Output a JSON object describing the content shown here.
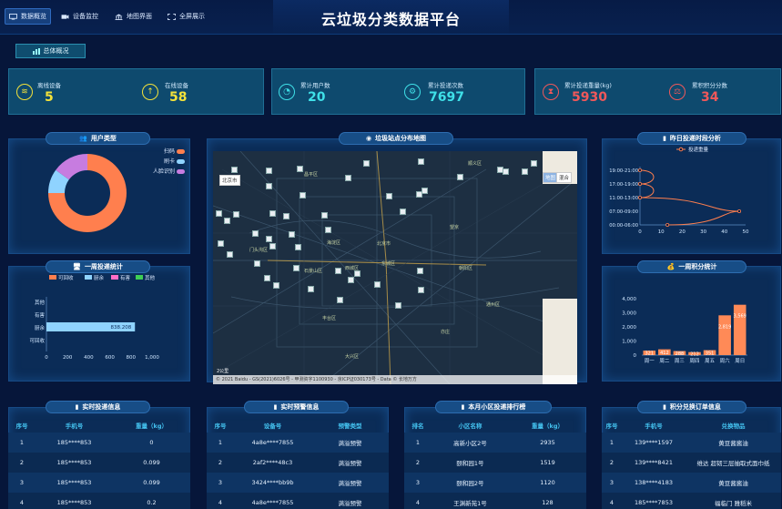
{
  "header": {
    "title": "云垃圾分类数据平台",
    "nav": [
      {
        "label": "数据概览",
        "icon": "monitor-icon",
        "active": true
      },
      {
        "label": "设备监控",
        "icon": "camera-icon",
        "active": false
      },
      {
        "label": "地图界面",
        "icon": "building-icon",
        "active": false
      },
      {
        "label": "全屏展示",
        "icon": "fullscreen-icon",
        "active": false
      }
    ]
  },
  "overview_tab": {
    "label": "总体概况"
  },
  "stats": [
    {
      "label": "离线设备",
      "value": "5",
      "color": "#f3e23a",
      "icon": "wifi-off-icon"
    },
    {
      "label": "在线设备",
      "value": "58",
      "color": "#f3e23a",
      "icon": "upload-icon"
    },
    {
      "label": "累计用户数",
      "value": "20",
      "color": "#3fe0e8",
      "icon": "user-circle-icon"
    },
    {
      "label": "累计投递次数",
      "value": "7697",
      "color": "#3fe0e8",
      "icon": "gear-icon"
    },
    {
      "label": "累计投递重量(kg)",
      "value": "5930",
      "color": "#f0585a",
      "icon": "hourglass-icon"
    },
    {
      "label": "累积积分分数",
      "value": "34",
      "color": "#f0585a",
      "icon": "scale-icon"
    }
  ],
  "user_type": {
    "title": "用户类型",
    "legend": [
      "扫码",
      "刷卡",
      "人脸识别"
    ],
    "colors": [
      "#ff7f4e",
      "#8fd3ff",
      "#c77ce0"
    ]
  },
  "weekly_delivery": {
    "title": "一周投递统计",
    "legend": [
      "可回收",
      "厨余",
      "有害",
      "其他"
    ],
    "colors": [
      "#ff7f4e",
      "#8fd3ff",
      "#ff6ec7",
      "#3ecf55"
    ]
  },
  "map_panel": {
    "title": "垃圾站点分布地图",
    "city_chip": "北京市",
    "map_types": [
      "地图",
      "混合"
    ],
    "copyright": "© 2021 Baidu - GS(2021)6026号 - 甲测资字1100930 - 京ICP证030173号 - Data © 长地万方",
    "scale": "2公里",
    "places": [
      "北京市",
      "海淀区",
      "西城区",
      "东城区",
      "朝阳区",
      "丰台区",
      "石景山区",
      "大兴区",
      "通州区",
      "昌平区",
      "顺义区",
      "门头沟区",
      "望京",
      "亦庄"
    ]
  },
  "yesterday_time": {
    "title": "昨日投递时段分析",
    "legend": "投递重量"
  },
  "weekly_points": {
    "title": "一周积分统计"
  },
  "chart_data": [
    {
      "type": "pie",
      "labels": [
        "扫码",
        "刷卡",
        "人脸识别"
      ],
      "values": [
        75,
        10,
        15
      ]
    },
    {
      "type": "bar",
      "orientation": "horizontal",
      "categories": [
        "可回收",
        "厨余",
        "有害",
        "其他"
      ],
      "series": [
        {
          "name": "厨余",
          "values": [
            0,
            838.208,
            0,
            0
          ]
        }
      ],
      "xlim": [
        0,
        1000
      ],
      "xticks": [
        "0",
        "200",
        "400",
        "600",
        "800",
        "1,000"
      ],
      "data_label": "838.208"
    },
    {
      "type": "line",
      "categories": [
        "00:00-06:00",
        "07:00-09:00",
        "11:00-13:00",
        "17:00-19:00",
        "19:00-21:00"
      ],
      "series": [
        {
          "name": "投递重量",
          "values": [
            13,
            47,
            0,
            0,
            0
          ]
        }
      ],
      "xlim": [
        0,
        50
      ],
      "xticks": [
        "0",
        "10",
        "20",
        "30",
        "40",
        "50"
      ]
    },
    {
      "type": "bar",
      "categories": [
        "周一",
        "周二",
        "周三",
        "周四",
        "周五",
        "周六",
        "周日"
      ],
      "values": [
        321,
        412,
        288,
        212,
        351,
        2819,
        3569
      ],
      "ylim": [
        0,
        4000
      ],
      "yticks": [
        "0",
        "1,000",
        "2,000",
        "3,000",
        "4,000"
      ]
    }
  ],
  "tables": [
    {
      "title": "实时投递信息",
      "headers": [
        "序号",
        "手机号",
        "重量（kg）"
      ],
      "rows": [
        [
          "1",
          "185****853",
          "0"
        ],
        [
          "2",
          "185****853",
          "0.099"
        ],
        [
          "3",
          "185****853",
          "0.099"
        ],
        [
          "4",
          "185****853",
          "0.2"
        ]
      ]
    },
    {
      "title": "实时预警信息",
      "headers": [
        "序号",
        "设备号",
        "预警类型"
      ],
      "rows": [
        [
          "1",
          "4a8e****7855",
          "满溢预警"
        ],
        [
          "2",
          "2af2****48c3",
          "满溢预警"
        ],
        [
          "3",
          "3424****bb9b",
          "满溢预警"
        ],
        [
          "4",
          "4a8e****7855",
          "满溢预警"
        ]
      ]
    },
    {
      "title": "本月小区投递排行榜",
      "headers": [
        "排名",
        "小区名称",
        "重量（kg）"
      ],
      "rows": [
        [
          "1",
          "高新小区2号",
          "2935"
        ],
        [
          "2",
          "颐和园1号",
          "1519"
        ],
        [
          "3",
          "颐和园2号",
          "1120"
        ],
        [
          "4",
          "王渊新苑1号",
          "128"
        ]
      ]
    },
    {
      "title": "积分兑换订单信息",
      "headers": [
        "序号",
        "手机号",
        "兑换物品"
      ],
      "rows": [
        [
          "1",
          "139****1597",
          "黄豆酱酱油"
        ],
        [
          "2",
          "139****8421",
          "维达 超韧三层抽取式面巾纸"
        ],
        [
          "3",
          "138****4183",
          "黄豆酱酱油"
        ],
        [
          "4",
          "185****7853",
          "福临门 雅稻米"
        ]
      ]
    }
  ]
}
